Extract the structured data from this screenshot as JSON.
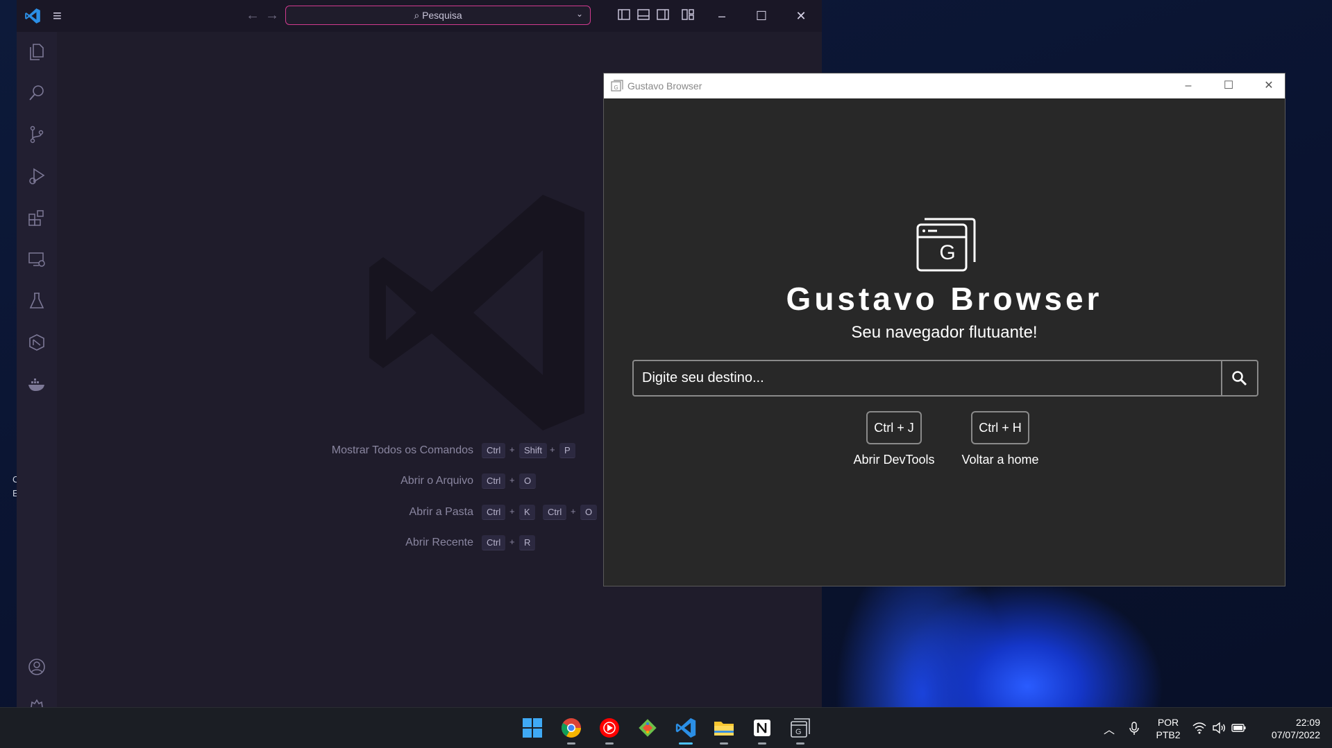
{
  "desktop": {
    "stub_lines": [
      "C",
      "E"
    ]
  },
  "vscode": {
    "search_label": "Pesquisa",
    "colors": {
      "accent": "#d13a8f",
      "bg": "#1f1c2b",
      "activity": "#221f31"
    },
    "activity_icons": [
      "explorer-icon",
      "search-icon",
      "source-control-icon",
      "run-debug-icon",
      "extensions-icon",
      "remote-explorer-icon",
      "testing-icon",
      "gitlens-icon",
      "docker-icon",
      "accounts-icon",
      "settings-gear-icon"
    ],
    "shortcuts": [
      {
        "label": "Mostrar Todos os Comandos",
        "keys": [
          "Ctrl",
          "Shift",
          "P"
        ]
      },
      {
        "label": "Abrir o Arquivo",
        "keys": [
          "Ctrl",
          "O"
        ]
      },
      {
        "label": "Abrir a Pasta",
        "keys": [
          "Ctrl",
          "K"
        ],
        "keys2": [
          "Ctrl",
          "O"
        ]
      },
      {
        "label": "Abrir Recente",
        "keys": [
          "Ctrl",
          "R"
        ]
      }
    ]
  },
  "browser": {
    "window_title": "Gustavo Browser",
    "logo_letter": "G",
    "app_name": "Gustavo Browser",
    "tagline": "Seu navegador flutuante!",
    "search_placeholder": "Digite seu destino...",
    "shortcuts": [
      {
        "key": "Ctrl + J",
        "label": "Abrir DevTools"
      },
      {
        "key": "Ctrl + H",
        "label": "Voltar a home"
      }
    ]
  },
  "taskbar": {
    "apps": [
      "start-icon",
      "chrome-icon",
      "youtube-music-icon",
      "git-icon",
      "vscode-icon",
      "file-explorer-icon",
      "notion-icon",
      "gustavo-browser-icon"
    ],
    "tray": {
      "lang_line1": "POR",
      "lang_line2": "PTB2",
      "time": "22:09",
      "date": "07/07/2022"
    }
  }
}
